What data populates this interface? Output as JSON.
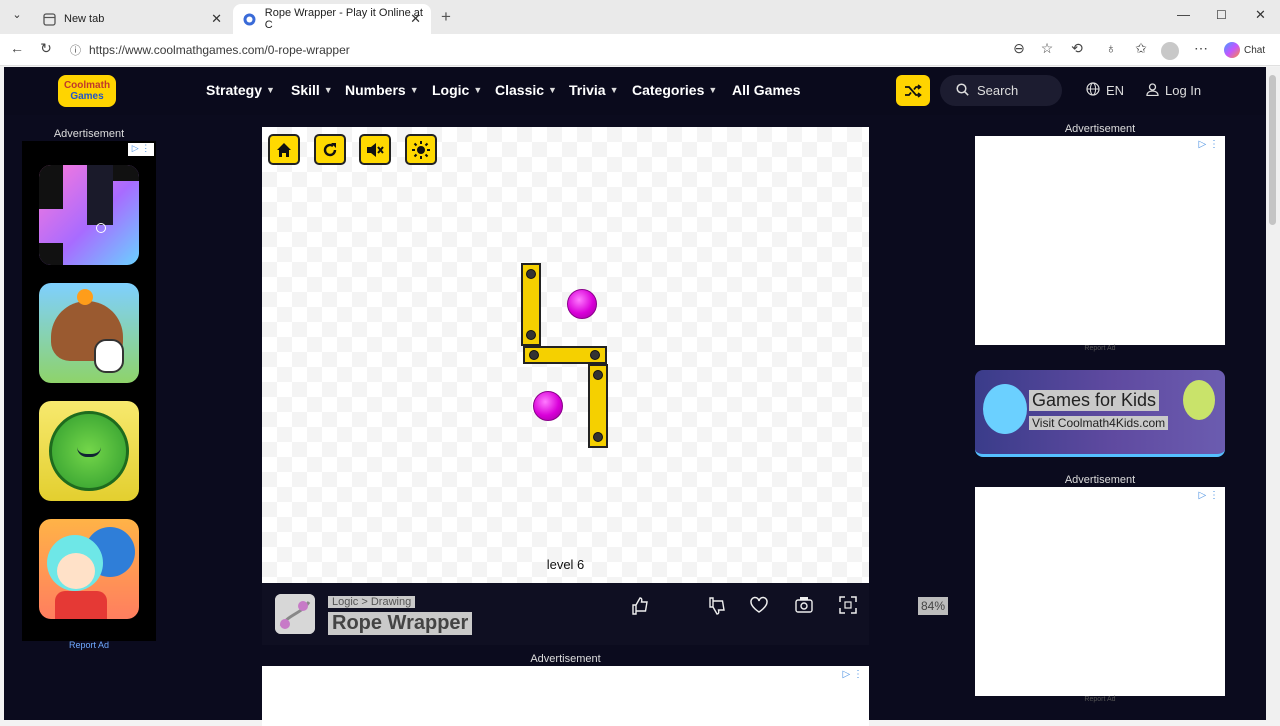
{
  "browser": {
    "tabs": [
      {
        "label": "New tab"
      },
      {
        "label": "Rope Wrapper - Play it Online at C"
      }
    ],
    "url": "https://www.coolmathgames.com/0-rope-wrapper",
    "chat_label": "Chat"
  },
  "header": {
    "logo_text_1": "Coolmath",
    "logo_text_2": "Games",
    "nav": [
      {
        "label": "Strategy"
      },
      {
        "label": "Skill"
      },
      {
        "label": "Numbers"
      },
      {
        "label": "Logic"
      },
      {
        "label": "Classic"
      },
      {
        "label": "Trivia"
      },
      {
        "label": "Categories"
      },
      {
        "label": "All Games"
      }
    ],
    "search_label": "Search",
    "language": "EN",
    "login": "Log In"
  },
  "left_ad": {
    "label": "Advertisement",
    "report": "Report Ad"
  },
  "game": {
    "level_text": "level 6",
    "colors": {
      "ball": "#e600e6",
      "plank": "#f5d000",
      "button": "#ffd900"
    }
  },
  "info": {
    "category": "Logic",
    "separator": ">",
    "subcategory": "Drawing",
    "title": "Rope Wrapper",
    "like_percent": "84%"
  },
  "bottom_ad": {
    "label": "Advertisement"
  },
  "right_ads": {
    "label_top": "Advertisement",
    "label_bottom": "Advertisement",
    "report": "Report Ad",
    "kids_title": "Games for Kids",
    "kids_sub": "Visit Coolmath4Kids.com"
  }
}
